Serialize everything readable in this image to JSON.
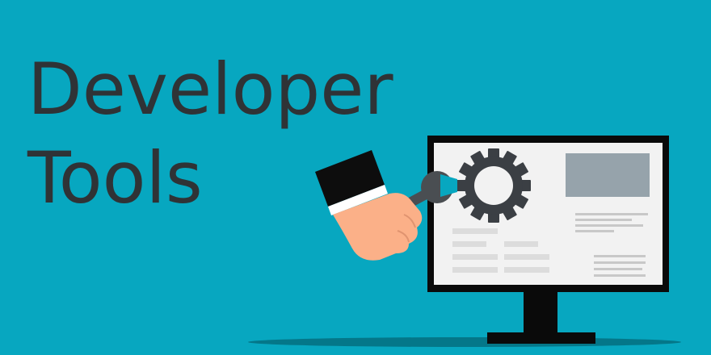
{
  "heading": {
    "line1": "Developer",
    "line2": "Tools"
  },
  "colors": {
    "background": "#07a7c0",
    "text": "#2f3336",
    "monitor": "#0a0a0a",
    "screen": "#f2f2f2",
    "gear": "#3b3f44",
    "wrench": "#4a4e52",
    "skin": "#fbb088",
    "sleeve": "#0d0d0d",
    "cuff": "#ffffff",
    "image_placeholder": "#96a3ab",
    "text_lines": "#c8c8c8",
    "shadow": "#046e7f"
  },
  "icons": [
    "gear-icon",
    "wrench-icon",
    "hand-illustration",
    "monitor-illustration"
  ]
}
